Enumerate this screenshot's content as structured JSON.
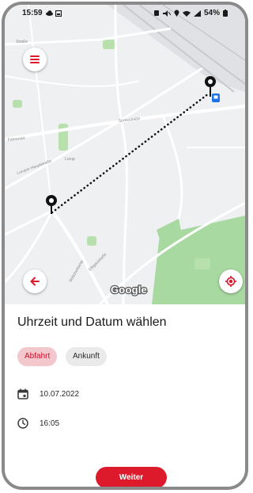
{
  "status_bar": {
    "time": "15:59",
    "battery": "54%"
  },
  "map": {
    "street_labels": [
      "Straße",
      "Fahrenort",
      "Spreestraße",
      "Lurup",
      "Luruper Hauptstraße",
      "Böttcherkamp",
      "Elbgaustraße"
    ],
    "attribution": "Google",
    "colors": {
      "route_pin": "#111111",
      "park": "#7fc97a",
      "station": "#1a73e8"
    }
  },
  "sheet": {
    "title": "Uhrzeit und Datum wählen",
    "chips": {
      "departure": "Abfahrt",
      "arrival": "Ankunft"
    },
    "date": "10.07.2022",
    "time": "16:05",
    "continue_label": "Weiter"
  },
  "colors": {
    "accent": "#dc1a2b",
    "chip_active_bg": "#f3c8cc",
    "chip_inactive_bg": "#eaeaea"
  },
  "icons": {
    "menu": "menu-icon",
    "back": "arrow-left-icon",
    "locate": "my-location-icon",
    "date": "calendar-icon",
    "time": "clock-icon"
  }
}
